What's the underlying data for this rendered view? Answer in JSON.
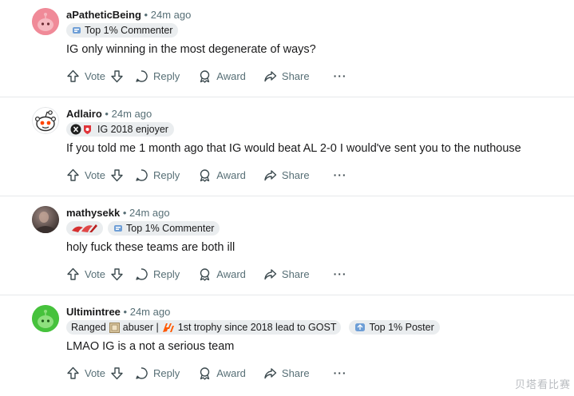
{
  "comments": [
    {
      "username": "aPatheticBeing",
      "time": "24m ago",
      "avatar_color": "#f08a98",
      "flairs": [
        {
          "icon": "top-commenter-badge-icon",
          "text": "Top 1% Commenter"
        }
      ],
      "body": "IG only winning in the most degenerate of ways?"
    },
    {
      "username": "Adlairo",
      "time": "24m ago",
      "avatar_color": "#ffffff",
      "flairs": [
        {
          "icon": "ig-logo-icon",
          "text": "IG 2018 enjoyer"
        }
      ],
      "body": "If you told me 1 month ago that IG would beat AL 2-0 I would've sent you to the nuthouse"
    },
    {
      "username": "mathysekk",
      "time": "24m ago",
      "avatar_color": "#5a4a48",
      "flairs": [
        {
          "icon": "team-logo-icon",
          "text": ""
        },
        {
          "icon": "top-commenter-badge-icon",
          "text": "Top 1% Commenter"
        }
      ],
      "body": "holy fuck these teams are both ill"
    },
    {
      "username": "Ultimintree",
      "time": "24m ago",
      "avatar_color": "#46c23c",
      "flairs_main": {
        "ranged": "Ranged",
        "abuser": "abuser |",
        "trophy": "1st trophy since 2018 lead to GOST"
      },
      "flair_poster": "Top 1% Poster",
      "body": "LMAO IG is a not a serious team"
    }
  ],
  "actions": {
    "vote": "Vote",
    "reply": "Reply",
    "award": "Award",
    "share": "Share",
    "more": "···"
  },
  "watermark": "贝塔看比赛",
  "colors": {
    "meta_gray": "#576f76",
    "flair_bg": "#eaedef",
    "divider": "#e6e8ea"
  }
}
